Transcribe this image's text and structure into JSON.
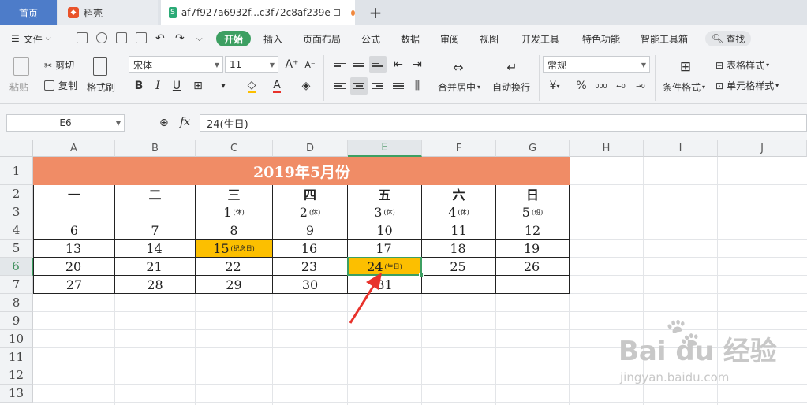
{
  "tabs": {
    "home": "首页",
    "docer": "稻壳",
    "file": "af7f927a6932f...c3f72c8af239e",
    "plus": "+"
  },
  "menu": {
    "file": "文件",
    "items": [
      "开始",
      "插入",
      "页面布局",
      "公式",
      "数据",
      "审阅",
      "视图",
      "开发工具",
      "特色功能",
      "智能工具箱"
    ],
    "search": "查找"
  },
  "ribbon": {
    "paste": "粘贴",
    "cut": "剪切",
    "copy": "复制",
    "format_painter": "格式刷",
    "font_name": "宋体",
    "font_size": "11",
    "merge_center": "合并居中",
    "wrap_text": "自动换行",
    "number_format": "常规",
    "currency": "¥",
    "percent": "%",
    "conditional_format": "条件格式",
    "table_style": "表格样式",
    "cell_style": "单元格样式"
  },
  "formula_bar": {
    "name_box": "E6",
    "fx": "fx",
    "content": "24(生日)"
  },
  "grid": {
    "columns": [
      "A",
      "B",
      "C",
      "D",
      "E",
      "F",
      "G",
      "H",
      "I",
      "J"
    ],
    "rows": [
      "1",
      "2",
      "3",
      "4",
      "5",
      "6",
      "7",
      "8",
      "9",
      "10",
      "11",
      "12",
      "13"
    ],
    "title": "2019年5月份",
    "weekdays": [
      "一",
      "二",
      "三",
      "四",
      "五",
      "六",
      "日"
    ],
    "week1": [
      {
        "day": "",
        "note": ""
      },
      {
        "day": "",
        "note": ""
      },
      {
        "day": "1",
        "note": "(休)"
      },
      {
        "day": "2",
        "note": "(休)"
      },
      {
        "day": "3",
        "note": "(休)"
      },
      {
        "day": "4",
        "note": "(休)"
      },
      {
        "day": "5",
        "note": "(班)"
      }
    ],
    "week2": [
      "6",
      "7",
      "8",
      "9",
      "10",
      "11",
      "12"
    ],
    "week3": [
      {
        "day": "13",
        "note": ""
      },
      {
        "day": "14",
        "note": ""
      },
      {
        "day": "15",
        "note": "(纪念日)"
      },
      {
        "day": "16",
        "note": ""
      },
      {
        "day": "17",
        "note": ""
      },
      {
        "day": "18",
        "note": ""
      },
      {
        "day": "19",
        "note": ""
      }
    ],
    "week4": [
      {
        "day": "20",
        "note": ""
      },
      {
        "day": "21",
        "note": ""
      },
      {
        "day": "22",
        "note": ""
      },
      {
        "day": "23",
        "note": ""
      },
      {
        "day": "24",
        "note": "(生日)"
      },
      {
        "day": "25",
        "note": ""
      },
      {
        "day": "26",
        "note": ""
      }
    ],
    "week5": [
      "27",
      "28",
      "29",
      "30",
      "31",
      "",
      ""
    ]
  },
  "watermark": {
    "brand": "Bai du 经验",
    "url": "jingyan.baidu.com"
  },
  "colors": {
    "title_bg": "#f08c66",
    "highlight": "#fcbf00",
    "accent_green": "#3d9f62",
    "arrow_red": "#e8322b"
  }
}
